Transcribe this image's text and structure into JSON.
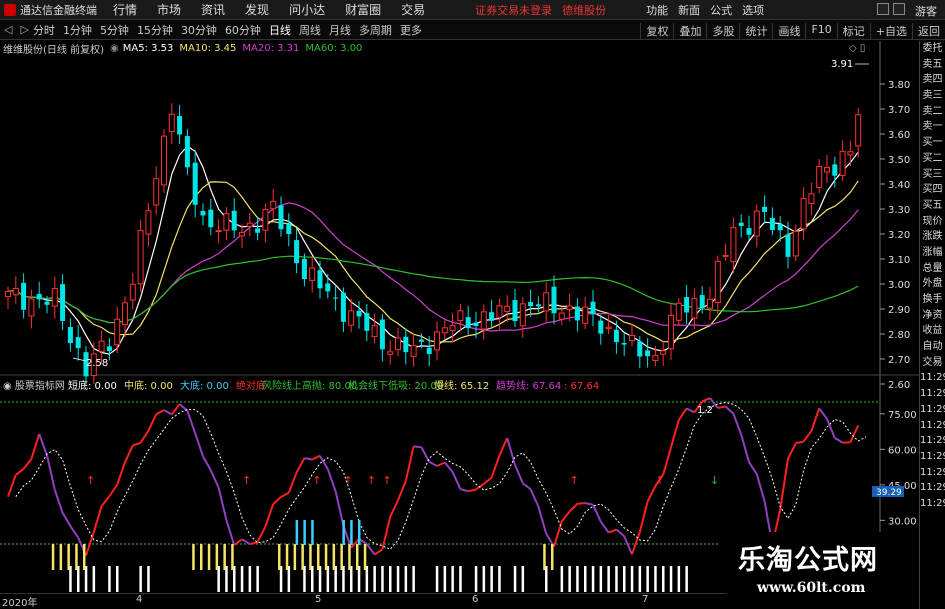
{
  "menubar": {
    "app_title": "通达信金融终端",
    "items": [
      "行情",
      "市场",
      "资讯",
      "发现",
      "问小达",
      "财富圈",
      "交易"
    ],
    "broker_status": "证券交易未登录",
    "broker_name": "德维股份",
    "right_items": [
      "功能",
      "新面",
      "公式",
      "选项"
    ],
    "guest": "游客"
  },
  "toolbar": {
    "periods": [
      "分时",
      "1分钟",
      "5分钟",
      "15分钟",
      "30分钟",
      "60分钟",
      "日线",
      "周线",
      "月线",
      "多周期",
      "更多"
    ],
    "active_period": "日线",
    "right_buttons": [
      "复权",
      "叠加",
      "多股",
      "统计",
      "画线",
      "F10",
      "标记",
      "+自选",
      "返回"
    ]
  },
  "main_chart": {
    "title": "维维股份(日线 前复权)",
    "ma": [
      {
        "label": "MA5: 3.53",
        "color": "#ffffff"
      },
      {
        "label": "MA10: 3.45",
        "color": "#f5e36a"
      },
      {
        "label": "MA20: 3.31",
        "color": "#d040d0"
      },
      {
        "label": "MA60: 3.00",
        "color": "#30c030"
      }
    ],
    "high_label": "3.91",
    "low_label": "2.58",
    "y_ticks": [
      "3.80",
      "3.70",
      "3.60",
      "3.50",
      "3.40",
      "3.30",
      "3.20",
      "3.10",
      "3.00",
      "2.90",
      "2.80",
      "2.70",
      "2.60"
    ]
  },
  "indicator": {
    "name": "股票指标网",
    "items": [
      {
        "label": "短底: 0.00",
        "color": "#ffffff"
      },
      {
        "label": "中底: 0.00",
        "color": "#f5e36a"
      },
      {
        "label": "大底: 0.00",
        "color": "#3fd0ff"
      },
      {
        "label": "绝对底",
        "color": "#ff3030"
      },
      {
        "label": "风险线上高抛: 80.00",
        "color": "#30c030"
      },
      {
        "label": "机会线下低吸: 20.00",
        "color": "#30c030"
      },
      {
        "label": "慢线: 65.12",
        "color": "#f5e36a"
      },
      {
        "label": "趋势线: 67.64",
        "color": "#d040d0"
      },
      {
        "label": ": 67.64",
        "color": "#ff3030"
      }
    ],
    "peak_label": "1.2",
    "y_ticks": [
      "75.00",
      "60.00",
      "45.00",
      "30.00"
    ],
    "highlight_value": "39.29"
  },
  "side_panel": [
    "委托",
    "卖五",
    "卖四",
    "卖三",
    "卖二",
    "卖一",
    "买一",
    "买二",
    "买三",
    "买四",
    "买五",
    "现价",
    "涨跌",
    "涨幅",
    "总量",
    "外盘",
    "换手",
    "净资",
    "收益",
    "自动",
    "交易",
    "11:29",
    "11:29",
    "11:29",
    "11:29",
    "11:29",
    "11:29",
    "11:29",
    "11:29",
    "11:29"
  ],
  "dates": [
    "2020年",
    "4",
    "5",
    "6",
    "7"
  ],
  "watermark": {
    "title": "乐淘公式网",
    "url": "www.60lt.com"
  },
  "colors": {
    "up": "#ff3030",
    "down": "#00e6e6",
    "ma5": "#ffffff",
    "ma10": "#f5e36a",
    "ma20": "#d040d0",
    "ma60": "#30c030"
  }
}
